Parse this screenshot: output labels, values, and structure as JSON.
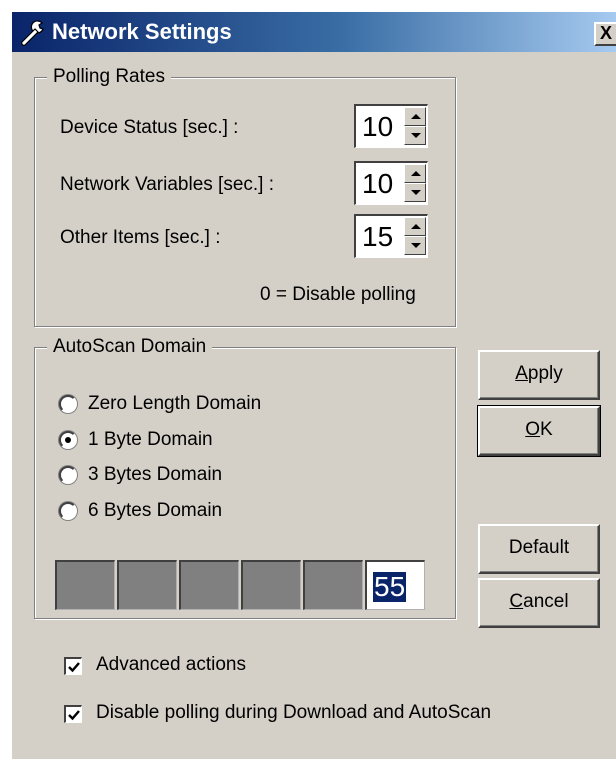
{
  "window": {
    "title": "Network Settings",
    "close_symbol": "X"
  },
  "polling": {
    "legend": "Polling Rates",
    "device_status": {
      "label": "Device Status [sec.] :",
      "value": "10"
    },
    "network_variables": {
      "label": "Network Variables [sec.] :",
      "value": "10"
    },
    "other_items": {
      "label": "Other Items [sec.] :",
      "value": "15"
    },
    "note": "0 = Disable polling"
  },
  "autoscan": {
    "legend": "AutoScan Domain",
    "options": [
      {
        "label": "Zero Length Domain",
        "selected": false
      },
      {
        "label": "1 Byte Domain",
        "selected": true
      },
      {
        "label": "3 Bytes Domain",
        "selected": false
      },
      {
        "label": "6 Bytes Domain",
        "selected": false
      }
    ],
    "domain_bytes": [
      "",
      "",
      "",
      "",
      "",
      "55"
    ]
  },
  "buttons": {
    "apply_underlined": "A",
    "apply_rest": "pply",
    "ok_underlined": "O",
    "ok_rest": "K",
    "default": "Default",
    "cancel_underlined": "C",
    "cancel_rest": "ancel"
  },
  "checkboxes": {
    "advanced_actions": {
      "label": "Advanced actions",
      "checked": true
    },
    "disable_polling": {
      "label": "Disable polling during Download and AutoScan",
      "checked": true
    }
  },
  "icons": {
    "title_icon": "wrench-icon",
    "checkmark": "checkmark-icon"
  },
  "colors": {
    "title_start": "#0a246a",
    "title_end": "#a6caf0",
    "face": "#d4d0c8",
    "selection": "#0a246a"
  }
}
